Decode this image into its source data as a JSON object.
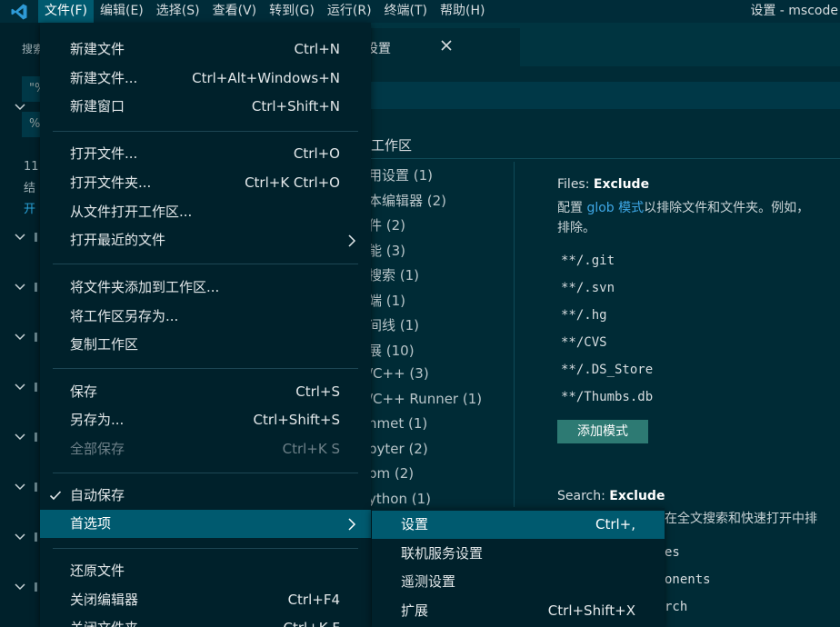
{
  "titlebar": {
    "menus": [
      "文件(F)",
      "编辑(E)",
      "选择(S)",
      "查看(V)",
      "转到(G)",
      "运行(R)",
      "终端(T)",
      "帮助(H)"
    ],
    "window_title": "设置 - mscode"
  },
  "sidebar": {
    "title": "搜索",
    "input1": "\"%",
    "input2": "%",
    "result_count": "11",
    "result_text": "结",
    "open_link": "开"
  },
  "editor": {
    "tab_label": "设置",
    "scope_tab": "工作区",
    "toc": [
      "用设置 (1)",
      "本编辑器 (2)",
      "件 (2)",
      "能 (3)",
      "搜索 (1)",
      "端 (1)",
      "间线 (1)",
      "展 (10)",
      "/C++ (3)",
      "/C++ Runner (1)",
      "nmet (1)",
      "pyter (2)",
      "pm (2)",
      "ython (1)"
    ],
    "files_exclude": {
      "title_prefix": "Files: ",
      "title_name": "Exclude",
      "desc_before": "配置 ",
      "desc_link": "glob 模式",
      "desc_after": "以排除文件和文件夹。例如，",
      "desc_line2": "排除。",
      "patterns": [
        "**/.git",
        "**/.svn",
        "**/.hg",
        "**/CVS",
        "**/.DS_Store",
        "**/Thumbs.db"
      ],
      "add_button": "添加模式"
    },
    "search_exclude": {
      "title_prefix": "Search: ",
      "title_name": "Exclude",
      "desc": "在全文搜索和快速打开中排",
      "patterns": [
        "es",
        "onents",
        "rch"
      ]
    }
  },
  "file_menu": {
    "items": [
      {
        "label": "新建文件",
        "key": "Ctrl+N"
      },
      {
        "label": "新建文件...",
        "key": "Ctrl+Alt+Windows+N"
      },
      {
        "label": "新建窗口",
        "key": "Ctrl+Shift+N"
      },
      {
        "label": "打开文件...",
        "key": "Ctrl+O"
      },
      {
        "label": "打开文件夹...",
        "key": "Ctrl+K Ctrl+O"
      },
      {
        "label": "从文件打开工作区...",
        "key": ""
      },
      {
        "label": "打开最近的文件",
        "key": ""
      },
      {
        "label": "将文件夹添加到工作区...",
        "key": ""
      },
      {
        "label": "将工作区另存为...",
        "key": ""
      },
      {
        "label": "复制工作区",
        "key": ""
      },
      {
        "label": "保存",
        "key": "Ctrl+S"
      },
      {
        "label": "另存为...",
        "key": "Ctrl+Shift+S"
      },
      {
        "label": "全部保存",
        "key": "Ctrl+K S"
      },
      {
        "label": "自动保存",
        "key": ""
      },
      {
        "label": "首选项",
        "key": ""
      },
      {
        "label": "还原文件",
        "key": ""
      },
      {
        "label": "关闭编辑器",
        "key": "Ctrl+F4"
      },
      {
        "label": "关闭文件夹",
        "key": "Ctrl+K F"
      }
    ]
  },
  "preferences_submenu": {
    "items": [
      {
        "label": "设置",
        "key": "Ctrl+,"
      },
      {
        "label": "联机服务设置",
        "key": ""
      },
      {
        "label": "遥测设置",
        "key": ""
      },
      {
        "label": "扩展",
        "key": "Ctrl+Shift+X"
      }
    ]
  }
}
